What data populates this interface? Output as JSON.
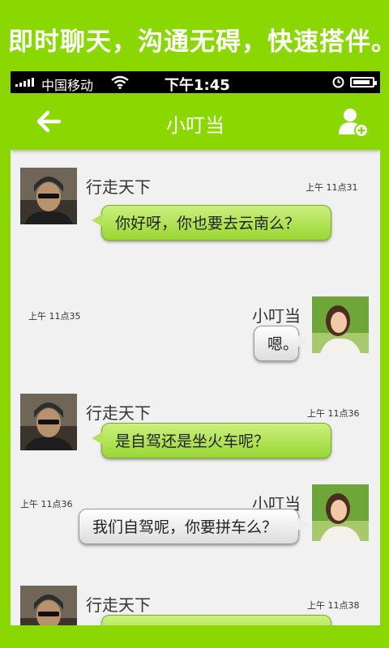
{
  "promo": {
    "text": "即时聊天，沟通无碍，快速搭伴。"
  },
  "statusbar": {
    "carrier": "中国移动",
    "time": "下午1:45"
  },
  "nav": {
    "title": "小叮当",
    "back_icon": "back-arrow-icon",
    "add_icon": "add-friend-icon"
  },
  "messages": [
    {
      "side": "left",
      "sender": "行走天下",
      "time": "上午  11点31",
      "text": "你好呀，你也要去云南么？"
    },
    {
      "side": "right",
      "sender": "小叮当",
      "time": "上午  11点35",
      "text": "嗯。"
    },
    {
      "side": "left",
      "sender": "行走天下",
      "time": "上午  11点36",
      "text": "是自驾还是坐火车呢？"
    },
    {
      "side": "right",
      "sender": "小叮当",
      "time": "上午  11点36",
      "text": "我们自驾呢，你要拼车么？"
    },
    {
      "side": "left",
      "sender": "行走天下",
      "time": "上午  11点38",
      "text": ""
    }
  ],
  "colors": {
    "accent": "#8bd701",
    "bubble_green": "#b5e25b",
    "bubble_gray": "#ededed"
  }
}
